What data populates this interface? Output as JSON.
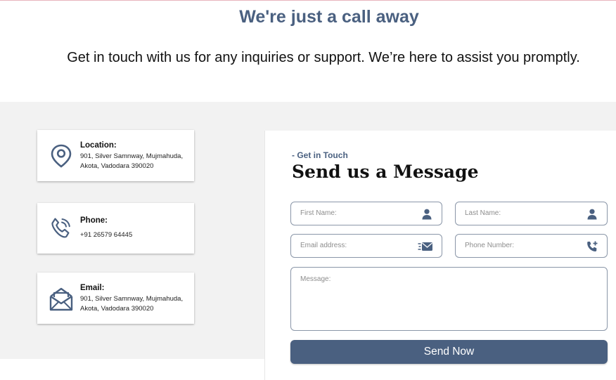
{
  "hero": {
    "title": "We're just a call away",
    "subtitle": "Get in touch with us for any inquiries or support. We’re here to assist you promptly."
  },
  "contact_cards": [
    {
      "icon": "location-pin-icon",
      "title": "Location:",
      "lines": [
        "901, Silver Samnway, Mujmahuda,",
        "Akota, Vadodara 390020"
      ]
    },
    {
      "icon": "phone-icon",
      "title": "Phone:",
      "lines": [
        "+91 26579 64445"
      ]
    },
    {
      "icon": "envelope-icon",
      "title": "Email:",
      "lines": [
        "901, Silver Samnway, Mujmahuda,",
        "Akota, Vadodara 390020"
      ]
    }
  ],
  "form": {
    "eyebrow": "-  Get in Touch",
    "title": "Send us a Message",
    "first_name_placeholder": "First Name:",
    "last_name_placeholder": "Last Name:",
    "email_placeholder": "Email address:",
    "phone_placeholder": "Phone Number:",
    "message_placeholder": "Message:",
    "submit_label": "Send Now"
  },
  "colors": {
    "accent": "#4a6080",
    "band_background": "#f2f2f2"
  }
}
